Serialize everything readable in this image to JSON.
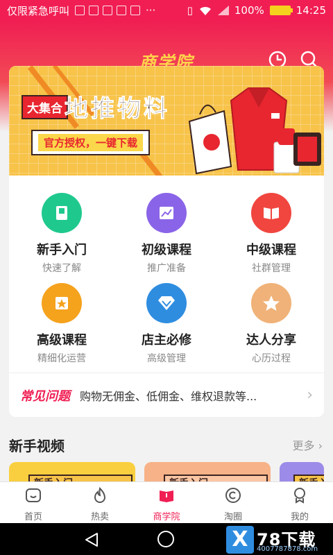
{
  "status_bar": {
    "carrier": "仅限紧急呼叫",
    "overflow": "···",
    "battery": "100%",
    "time": "14:25"
  },
  "header": {
    "title": "商学院",
    "icons": [
      "clock-icon",
      "search-icon"
    ]
  },
  "banner": {
    "tag": "大集合",
    "title": "地推物料",
    "subtitle": "官方授权，一键下载"
  },
  "menu": [
    {
      "label": "新手入门",
      "sub": "快速了解",
      "icon": "book-icon",
      "color": "#1fc98e"
    },
    {
      "label": "初级课程",
      "sub": "推广准备",
      "icon": "chart-icon",
      "color": "#8a64e8"
    },
    {
      "label": "中级课程",
      "sub": "社群管理",
      "icon": "open-book-icon",
      "color": "#f0463f"
    },
    {
      "label": "高级课程",
      "sub": "精细化运营",
      "icon": "star-box-icon",
      "color": "#f5a21d"
    },
    {
      "label": "店主必修",
      "sub": "高级管理",
      "icon": "diamond-icon",
      "color": "#2f8de0"
    },
    {
      "label": "达人分享",
      "sub": "心历过程",
      "icon": "star-icon",
      "color": "#f0b278"
    }
  ],
  "faq": {
    "tag": "常见问题",
    "text": "购物无佣金、低佣金、维权退款等..."
  },
  "section": {
    "title": "新手视频",
    "more": "更多",
    "thumb_text": "新手入门"
  },
  "bottom_nav": [
    {
      "label": "首页",
      "icon": "home-icon",
      "active": false
    },
    {
      "label": "热卖",
      "icon": "flame-icon",
      "active": false
    },
    {
      "label": "商学院",
      "icon": "college-icon",
      "active": true
    },
    {
      "label": "淘圈",
      "icon": "circle-icon",
      "active": false
    },
    {
      "label": "我的",
      "icon": "profile-icon",
      "active": false
    }
  ],
  "watermark": {
    "x": "X",
    "title": "78下载",
    "sub": "4007787878.com"
  },
  "colors": {
    "brand": "#f01e53",
    "title_gold": "#ffd34a",
    "banner_bg": "#f7c349"
  }
}
